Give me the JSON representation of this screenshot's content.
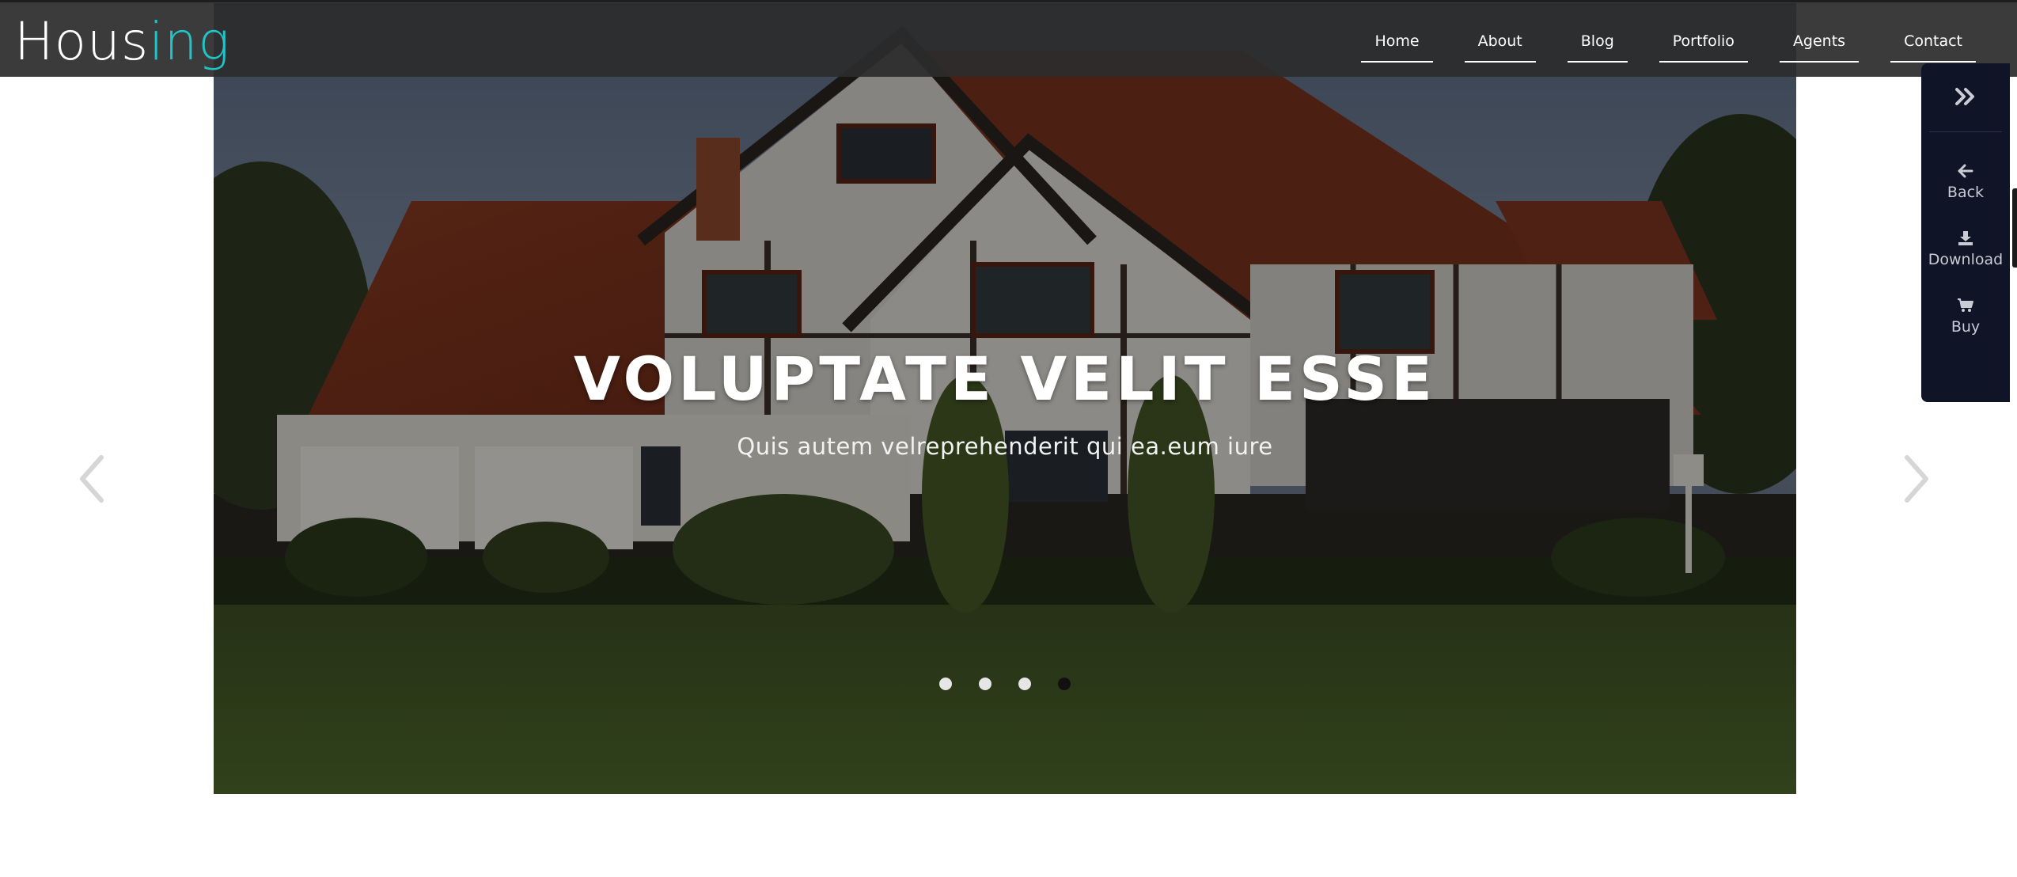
{
  "brand": {
    "logo_main": "Hous",
    "logo_accent": "ing",
    "accent_color": "#22c3c8"
  },
  "nav": {
    "items": [
      {
        "label": "Home"
      },
      {
        "label": "About"
      },
      {
        "label": "Blog"
      },
      {
        "label": "Portfolio"
      },
      {
        "label": "Agents"
      },
      {
        "label": "Contact"
      }
    ]
  },
  "hero": {
    "title": "VOLUPTATE VELIT ESSE",
    "subtitle": "Quis autem velreprehenderit qui ea.eum iure",
    "slide_count": 4,
    "active_slide": 4
  },
  "slider": {
    "prev_icon": "chevron-left-icon",
    "next_icon": "chevron-right-icon"
  },
  "side_panel": {
    "toggle_icon": "double-chevron-right-icon",
    "items": [
      {
        "label": "Back",
        "icon": "arrow-left-icon"
      },
      {
        "label": "Download",
        "icon": "download-icon"
      },
      {
        "label": "Buy",
        "icon": "cart-icon"
      }
    ],
    "background": "#0f1427"
  }
}
